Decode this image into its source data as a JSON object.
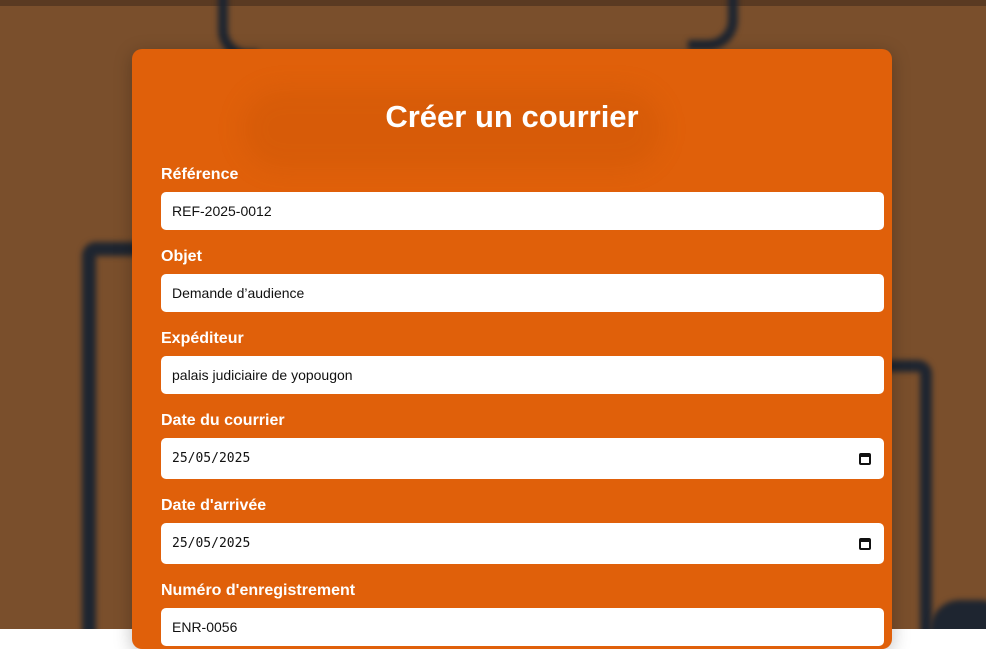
{
  "form": {
    "title": "Créer un courrier",
    "fields": [
      {
        "label": "Référence",
        "value": "REF-2025-0012"
      },
      {
        "label": "Objet",
        "value": "Demande d’audience"
      },
      {
        "label": "Expéditeur",
        "value": "palais judiciaire de yopougon"
      },
      {
        "label": "Date du courrier",
        "value": "25/05/2025",
        "icon": "calendar-icon"
      },
      {
        "label": "Date d'arrivée",
        "value": "25/05/2025",
        "icon": "calendar-icon"
      },
      {
        "label": "Numéro d'enregistrement",
        "value": "ENR-0056"
      }
    ]
  },
  "colors": {
    "card": "#e0600a",
    "background": "#7a4f2c",
    "text": "#ffffff"
  }
}
